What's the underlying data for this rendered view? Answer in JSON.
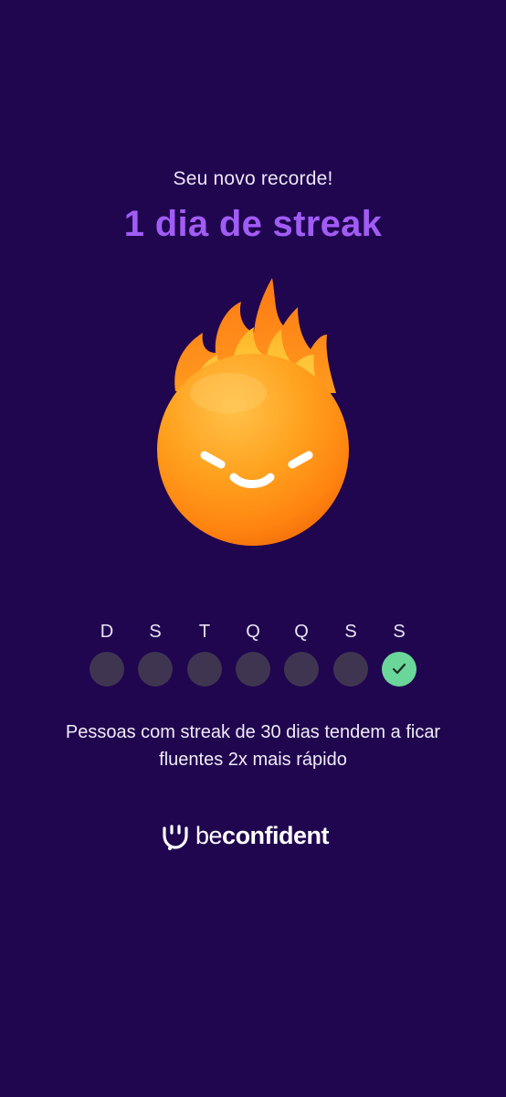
{
  "header": {
    "subtitle": "Seu novo recorde!",
    "title": "1 dia de streak"
  },
  "mascot": {
    "icon": "fire-ball-mascot-icon"
  },
  "week": {
    "days": [
      {
        "letter": "D",
        "done": false
      },
      {
        "letter": "S",
        "done": false
      },
      {
        "letter": "T",
        "done": false
      },
      {
        "letter": "Q",
        "done": false
      },
      {
        "letter": "Q",
        "done": false
      },
      {
        "letter": "S",
        "done": false
      },
      {
        "letter": "S",
        "done": true
      }
    ],
    "check_icon": "check-icon"
  },
  "info": {
    "text": "Pessoas com streak de 30 dias tendem a ficar fluentes 2x mais rápido"
  },
  "brand": {
    "light": "be",
    "bold": "confident",
    "logo_icon": "smile-logo-icon"
  },
  "colors": {
    "background": "#20054f",
    "accent": "#a15cf5",
    "day_inactive": "#3f3551",
    "day_done": "#6bd69a"
  }
}
